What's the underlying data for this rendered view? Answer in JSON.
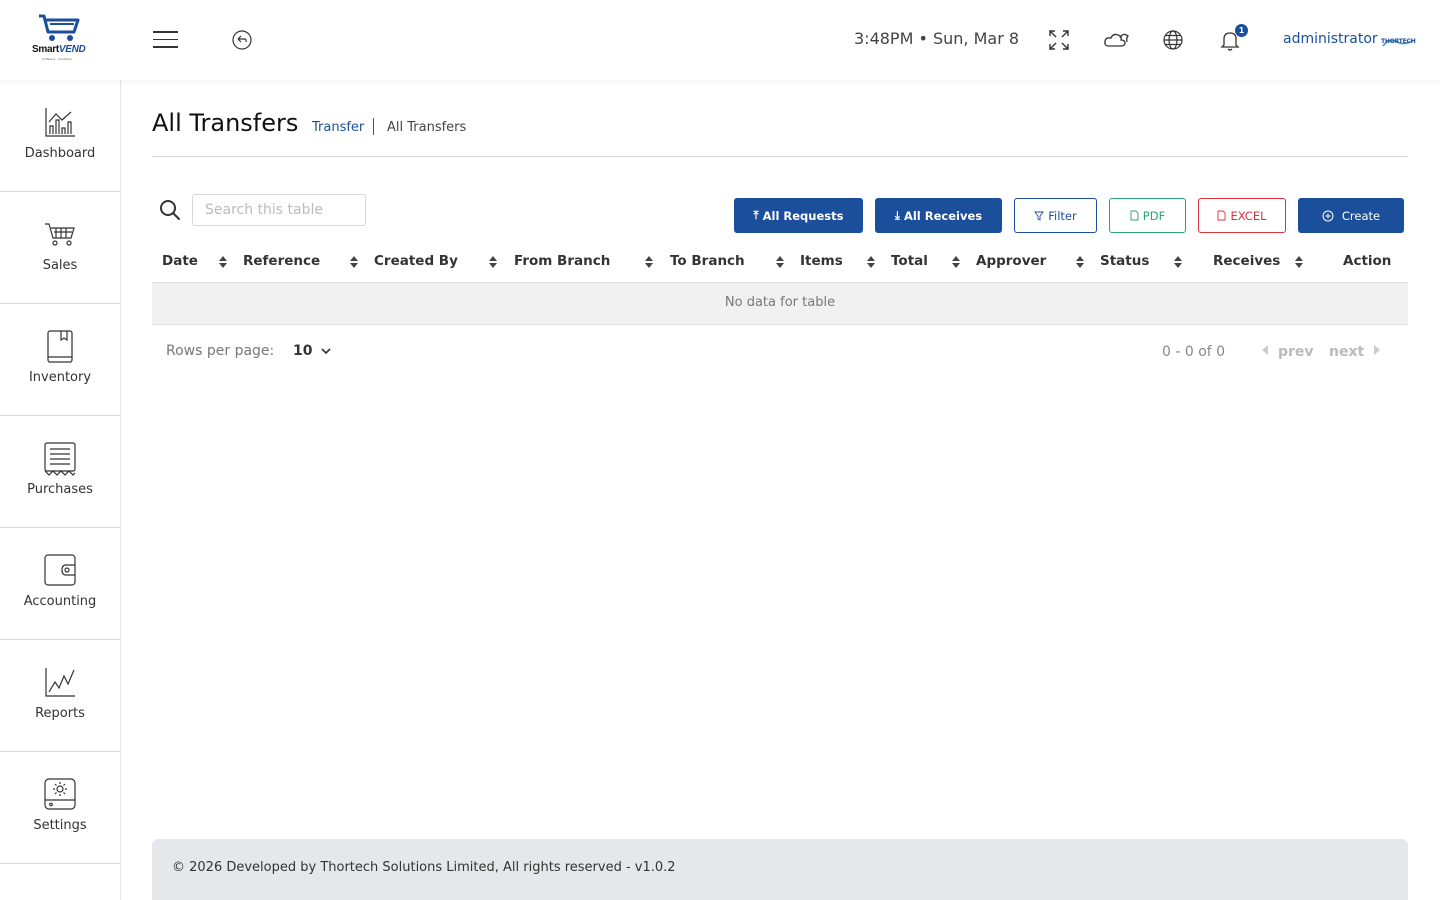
{
  "app": {
    "logo_name": "Smart",
    "logo_name_accent": "VEND",
    "logo_tagline": "Software · Solutions",
    "clock": "3:48PM • Sun, Mar 8",
    "notification_count": "1",
    "user": "administrator",
    "company_logo": "THORTECH"
  },
  "sidebar": {
    "items": [
      {
        "label": "Dashboard",
        "icon": "bar-chart-icon"
      },
      {
        "label": "Sales",
        "icon": "cart-icon"
      },
      {
        "label": "Inventory",
        "icon": "book-icon"
      },
      {
        "label": "Purchases",
        "icon": "receipt-icon"
      },
      {
        "label": "Accounting",
        "icon": "wallet-icon"
      },
      {
        "label": "Reports",
        "icon": "line-chart-icon"
      },
      {
        "label": "Settings",
        "icon": "settings-icon"
      }
    ]
  },
  "page": {
    "title": "All Transfers",
    "breadcrumb": [
      "Transfer",
      "All Transfers"
    ]
  },
  "toolbar": {
    "search_placeholder": "Search this table",
    "all_requests": "All Requests",
    "all_receives": "All Receives",
    "filter": "Filter",
    "pdf": "PDF",
    "excel": "EXCEL",
    "create": "Create"
  },
  "table": {
    "columns": [
      "Date",
      "Reference",
      "Created By",
      "From Branch",
      "To Branch",
      "Items",
      "Total",
      "Approver",
      "Status",
      "Receives",
      "Action"
    ],
    "empty_text": "No data for table"
  },
  "pagination": {
    "rows_per_page_label": "Rows per page:",
    "rows_per_page": "10",
    "range": "0 - 0 of 0",
    "prev": "prev",
    "next": "next"
  },
  "footer": {
    "text": "© 2026 Developed by Thortech Solutions Limited, All rights reserved - v1.0.2"
  },
  "colors": {
    "primary": "#1b4f9c",
    "pdf": "#2aa574",
    "excel": "#d8343f"
  }
}
